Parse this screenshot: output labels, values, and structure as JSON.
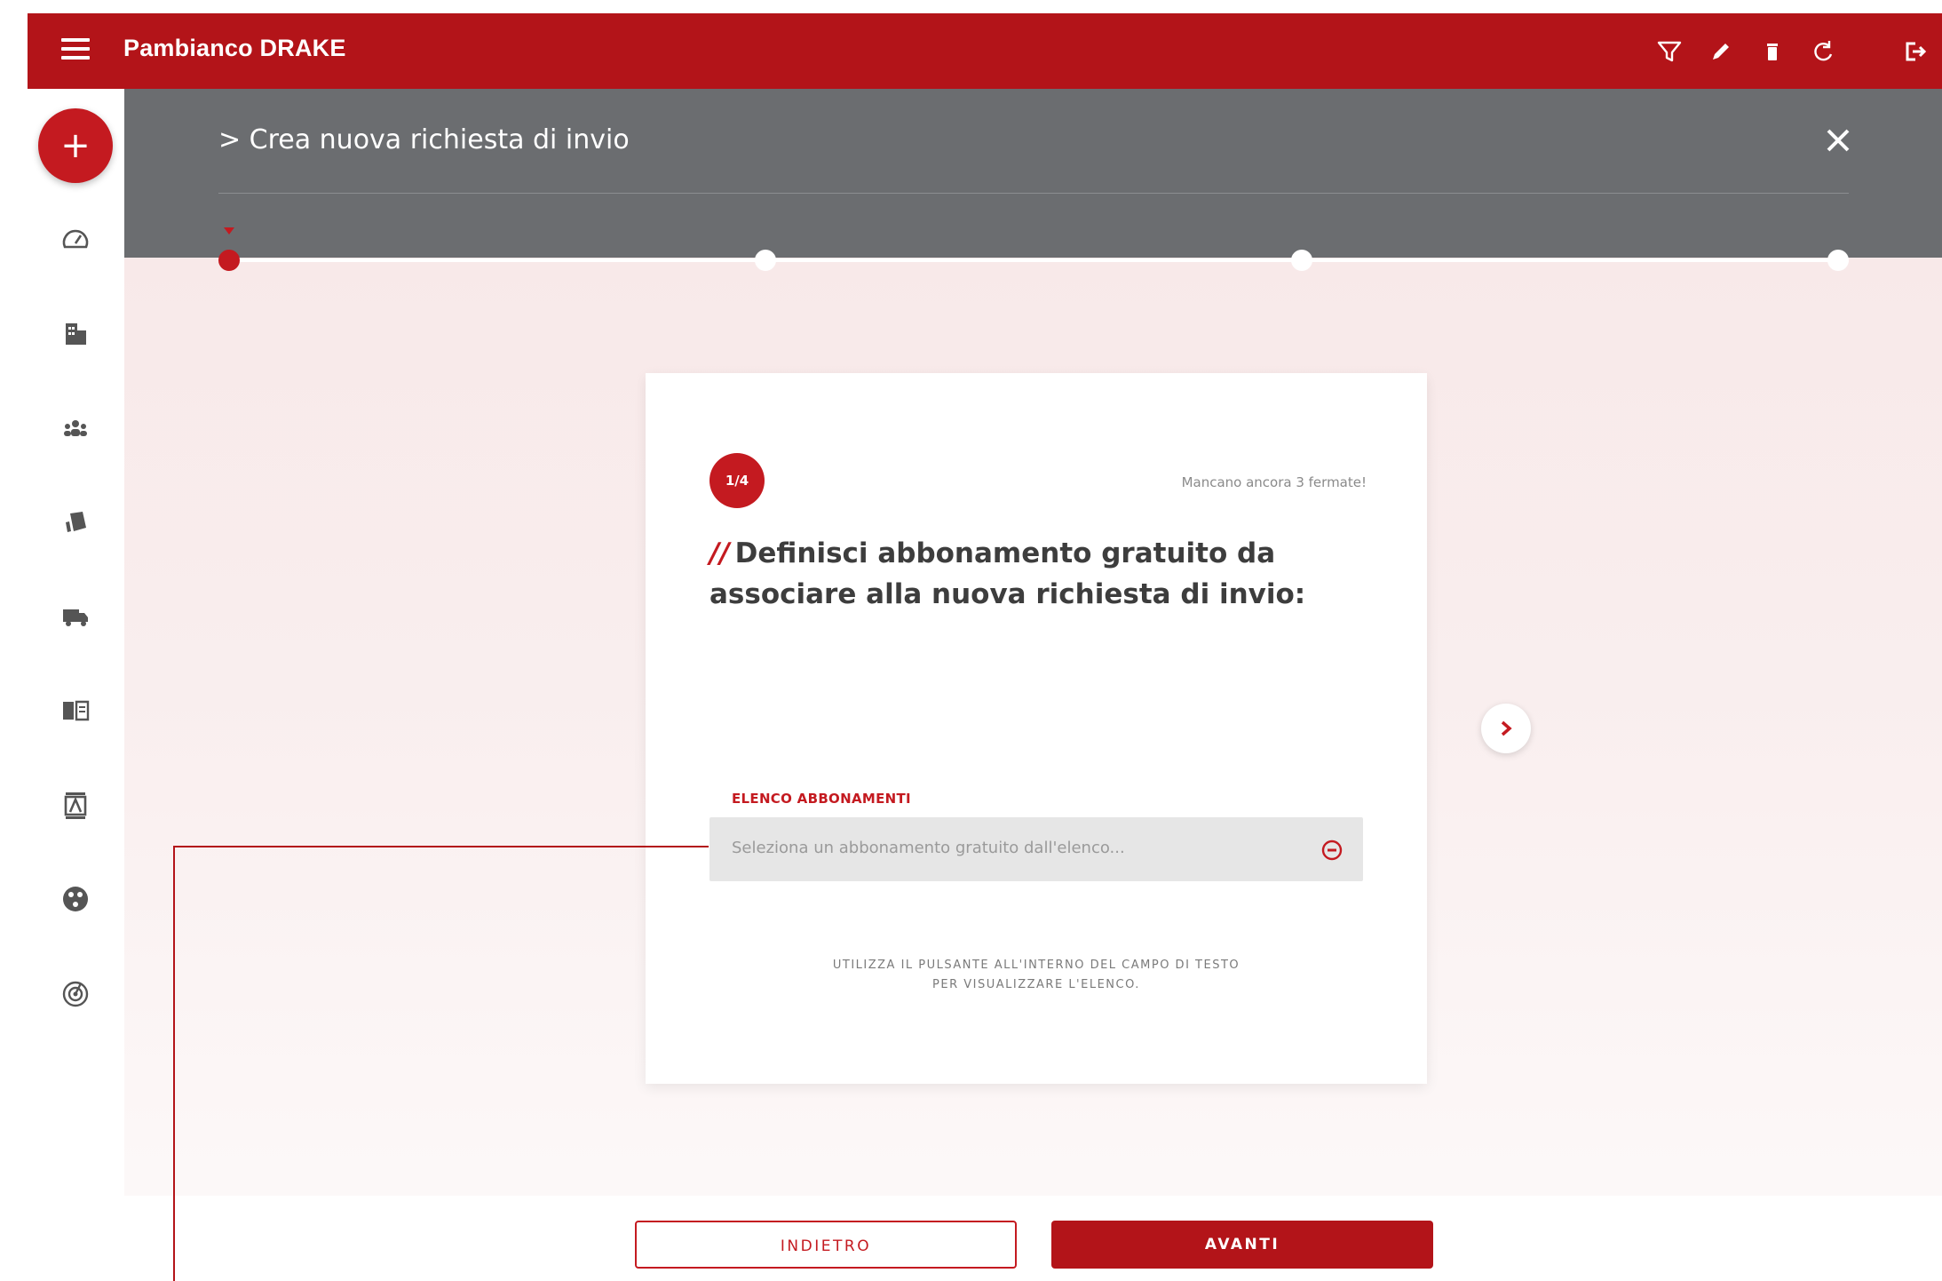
{
  "app": {
    "title": "Pambianco DRAKE"
  },
  "topbar": {
    "icons": [
      "filter-icon",
      "edit-icon",
      "delete-icon",
      "refresh-icon",
      "logout-icon"
    ]
  },
  "sidebar": {
    "fab_label": "+",
    "items": [
      "dashboard-icon",
      "buildings-icon",
      "people-icon",
      "tags-icon",
      "truck-icon",
      "book-icon",
      "contacts-icon",
      "palette-icon",
      "target-icon"
    ]
  },
  "header": {
    "breadcrumb": "> Crea nuova richiesta di invio",
    "steps": 4,
    "current_step": 1
  },
  "card": {
    "step_badge": "1/4",
    "remaining": "Mancano ancora 3 fermate!",
    "title_slashes": "//",
    "title": "Definisci abbonamento gratuito da associare alla nuova richiesta di invio:",
    "field_label": "ELENCO ABBONAMENTI",
    "field_placeholder": "Seleziona un abbonamento gratuito dall'elenco...",
    "hint_line1": "UTILIZZA IL PULSANTE ALL'INTERNO DEL CAMPO DI TESTO",
    "hint_line2": "PER VISUALIZZARE L'ELENCO."
  },
  "footer": {
    "back_label": "INDIETRO",
    "next_label": "AVANTI"
  },
  "colors": {
    "brand_red": "#b31419",
    "accent_red": "#c41a20",
    "header_gray": "#6b6d70"
  }
}
